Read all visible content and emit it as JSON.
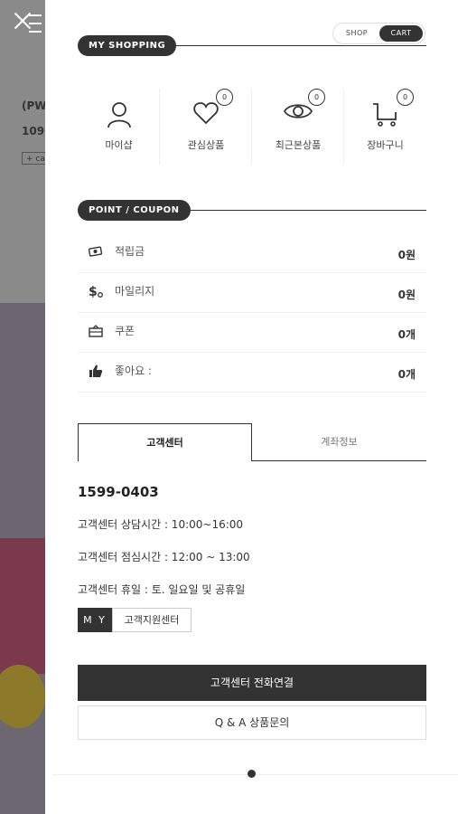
{
  "background": {
    "product_code": "(PW",
    "product_price": "109,",
    "tag": "+ ca"
  },
  "toggle": {
    "shop": "SHOP",
    "cart": "CART"
  },
  "my_shopping": {
    "title": "MY SHOPPING",
    "items": [
      {
        "label": "마이샵",
        "icon": "user-icon"
      },
      {
        "label": "관심상품",
        "icon": "heart-icon",
        "badge": "0"
      },
      {
        "label": "최근본상품",
        "icon": "eye-icon",
        "badge": "0"
      },
      {
        "label": "장바구니",
        "icon": "cart-icon",
        "badge": "0"
      }
    ]
  },
  "point_coupon": {
    "title": "POINT / COUPON",
    "rows": [
      {
        "label": "적립금",
        "value": "0원",
        "icon": "money-icon"
      },
      {
        "label": "마일리지",
        "value": "0원",
        "icon": "mileage-icon"
      },
      {
        "label": "쿠폰",
        "value": "0개",
        "icon": "coupon-icon"
      },
      {
        "label": "좋아요 :",
        "value": "0개",
        "icon": "thumbs-up-icon"
      }
    ]
  },
  "tabs": {
    "active": "고객센터",
    "inactive": "계좌정보"
  },
  "cs": {
    "phone": "1599-0403",
    "hours": "고객센터 상담시간 : 10:00~16:00",
    "lunch": "고객센터 점심시간 : 12:00 ~ 13:00",
    "holiday": "고객센터 휴일 : 토. 일요일 및 공휴일",
    "btn_my": "M Y",
    "btn_support": "고객지원센터",
    "call_button": "고객센터 전화연결",
    "qna_button": "Q & A 상품문의"
  }
}
